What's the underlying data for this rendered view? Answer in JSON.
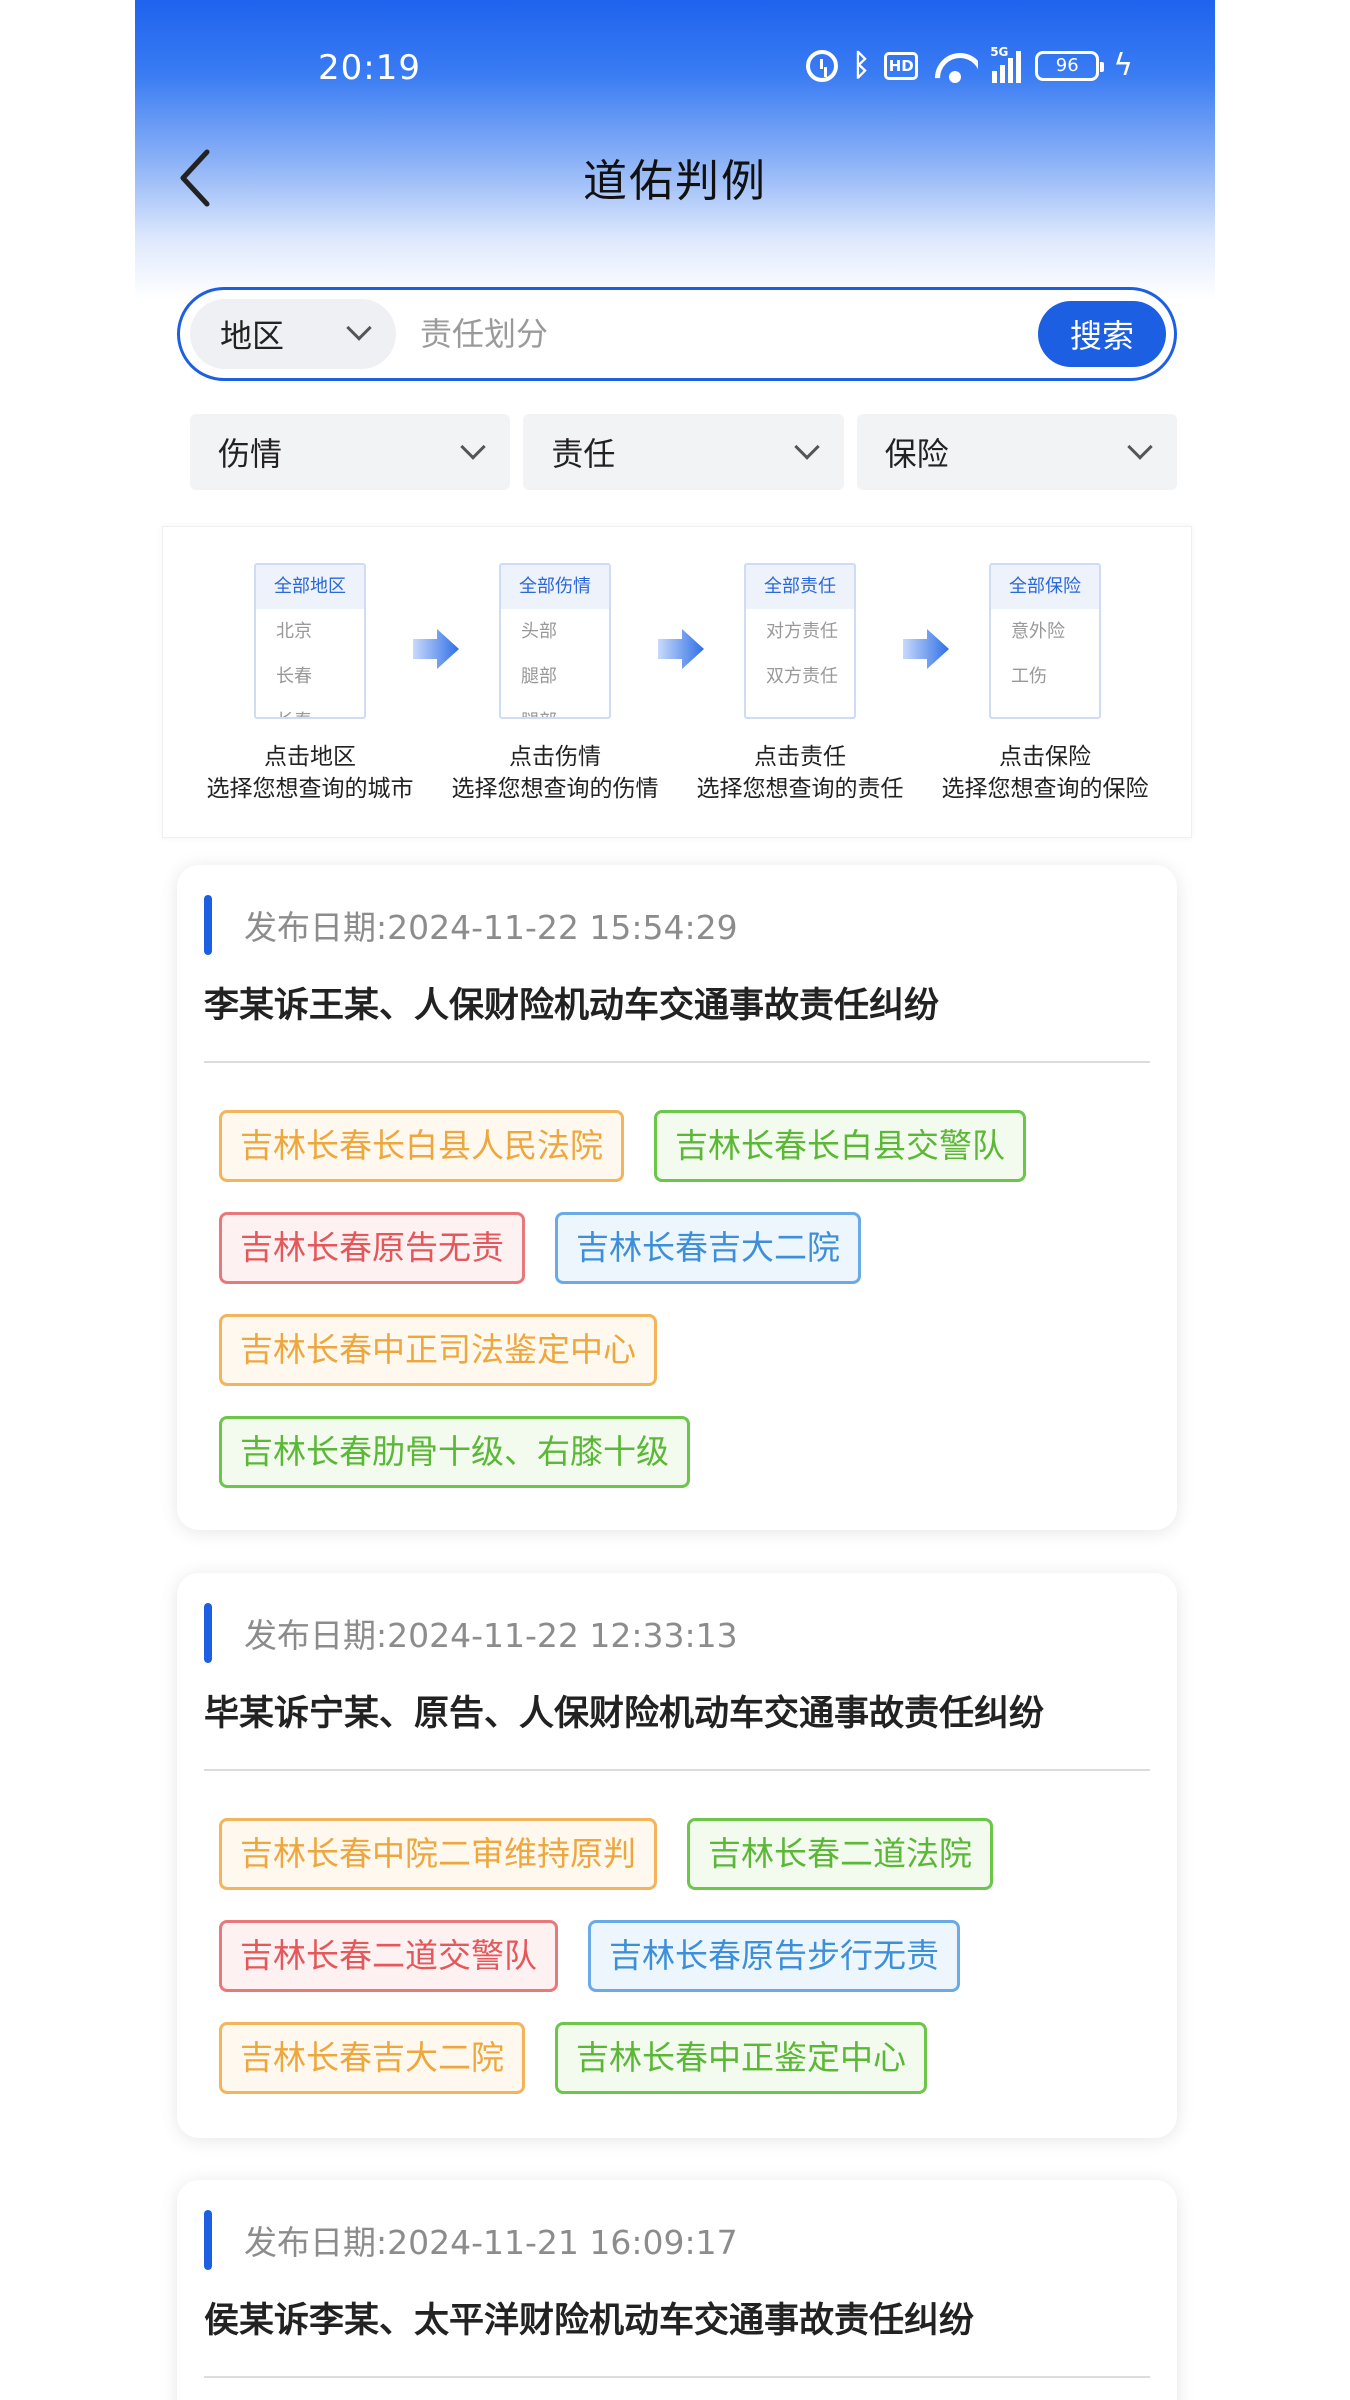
{
  "status": {
    "time": "20:19",
    "battery": "96",
    "signal_label": "5G"
  },
  "header": {
    "title": "道佑判例"
  },
  "search": {
    "region_label": "地区",
    "placeholder": "责任划分",
    "button_label": "搜索"
  },
  "filters": [
    {
      "label": "伤情"
    },
    {
      "label": "责任"
    },
    {
      "label": "保险"
    }
  ],
  "guide": [
    {
      "head": "全部地区",
      "items": [
        "北京",
        "长春",
        "长春"
      ],
      "line1": "点击地区",
      "line2": "选择您想查询的城市"
    },
    {
      "head": "全部伤情",
      "items": [
        "头部",
        "腿部",
        "腿部"
      ],
      "line1": "点击伤情",
      "line2": "选择您想查询的伤情"
    },
    {
      "head": "全部责任",
      "items": [
        "对方责任",
        "双方责任"
      ],
      "line1": "点击责任",
      "line2": "选择您想查询的责任"
    },
    {
      "head": "全部保险",
      "items": [
        "意外险",
        "工伤"
      ],
      "line1": "点击保险",
      "line2": "选择您想查询的保险"
    }
  ],
  "date_label": "发布日期:",
  "cases": [
    {
      "date": "2024-11-22 15:54:29",
      "title": "李某诉王某、人保财险机动车交通事故责任纠纷",
      "tags": [
        {
          "text": "吉林长春长白县人民法院",
          "color": "orange"
        },
        {
          "text": "吉林长春长白县交警队",
          "color": "green"
        },
        {
          "text": "吉林长春原告无责",
          "color": "red"
        },
        {
          "text": "吉林长春吉大二院",
          "color": "blue"
        },
        {
          "text": "吉林长春中正司法鉴定中心",
          "color": "orange"
        },
        {
          "text": "吉林长春肋骨十级、右膝十级",
          "color": "green"
        }
      ]
    },
    {
      "date": "2024-11-22 12:33:13",
      "title": "毕某诉宁某、原告、人保财险机动车交通事故责任纠纷",
      "tags": [
        {
          "text": "吉林长春中院二审维持原判",
          "color": "orange"
        },
        {
          "text": "吉林长春二道法院",
          "color": "green"
        },
        {
          "text": "吉林长春二道交警队",
          "color": "red"
        },
        {
          "text": "吉林长春原告步行无责",
          "color": "blue"
        },
        {
          "text": "吉林长春吉大二院",
          "color": "orange"
        },
        {
          "text": "吉林长春中正鉴定中心",
          "color": "green"
        }
      ]
    },
    {
      "date": "2024-11-21 16:09:17",
      "title": "侯某诉李某、太平洋财险机动车交通事故责任纠纷",
      "tags": []
    }
  ]
}
